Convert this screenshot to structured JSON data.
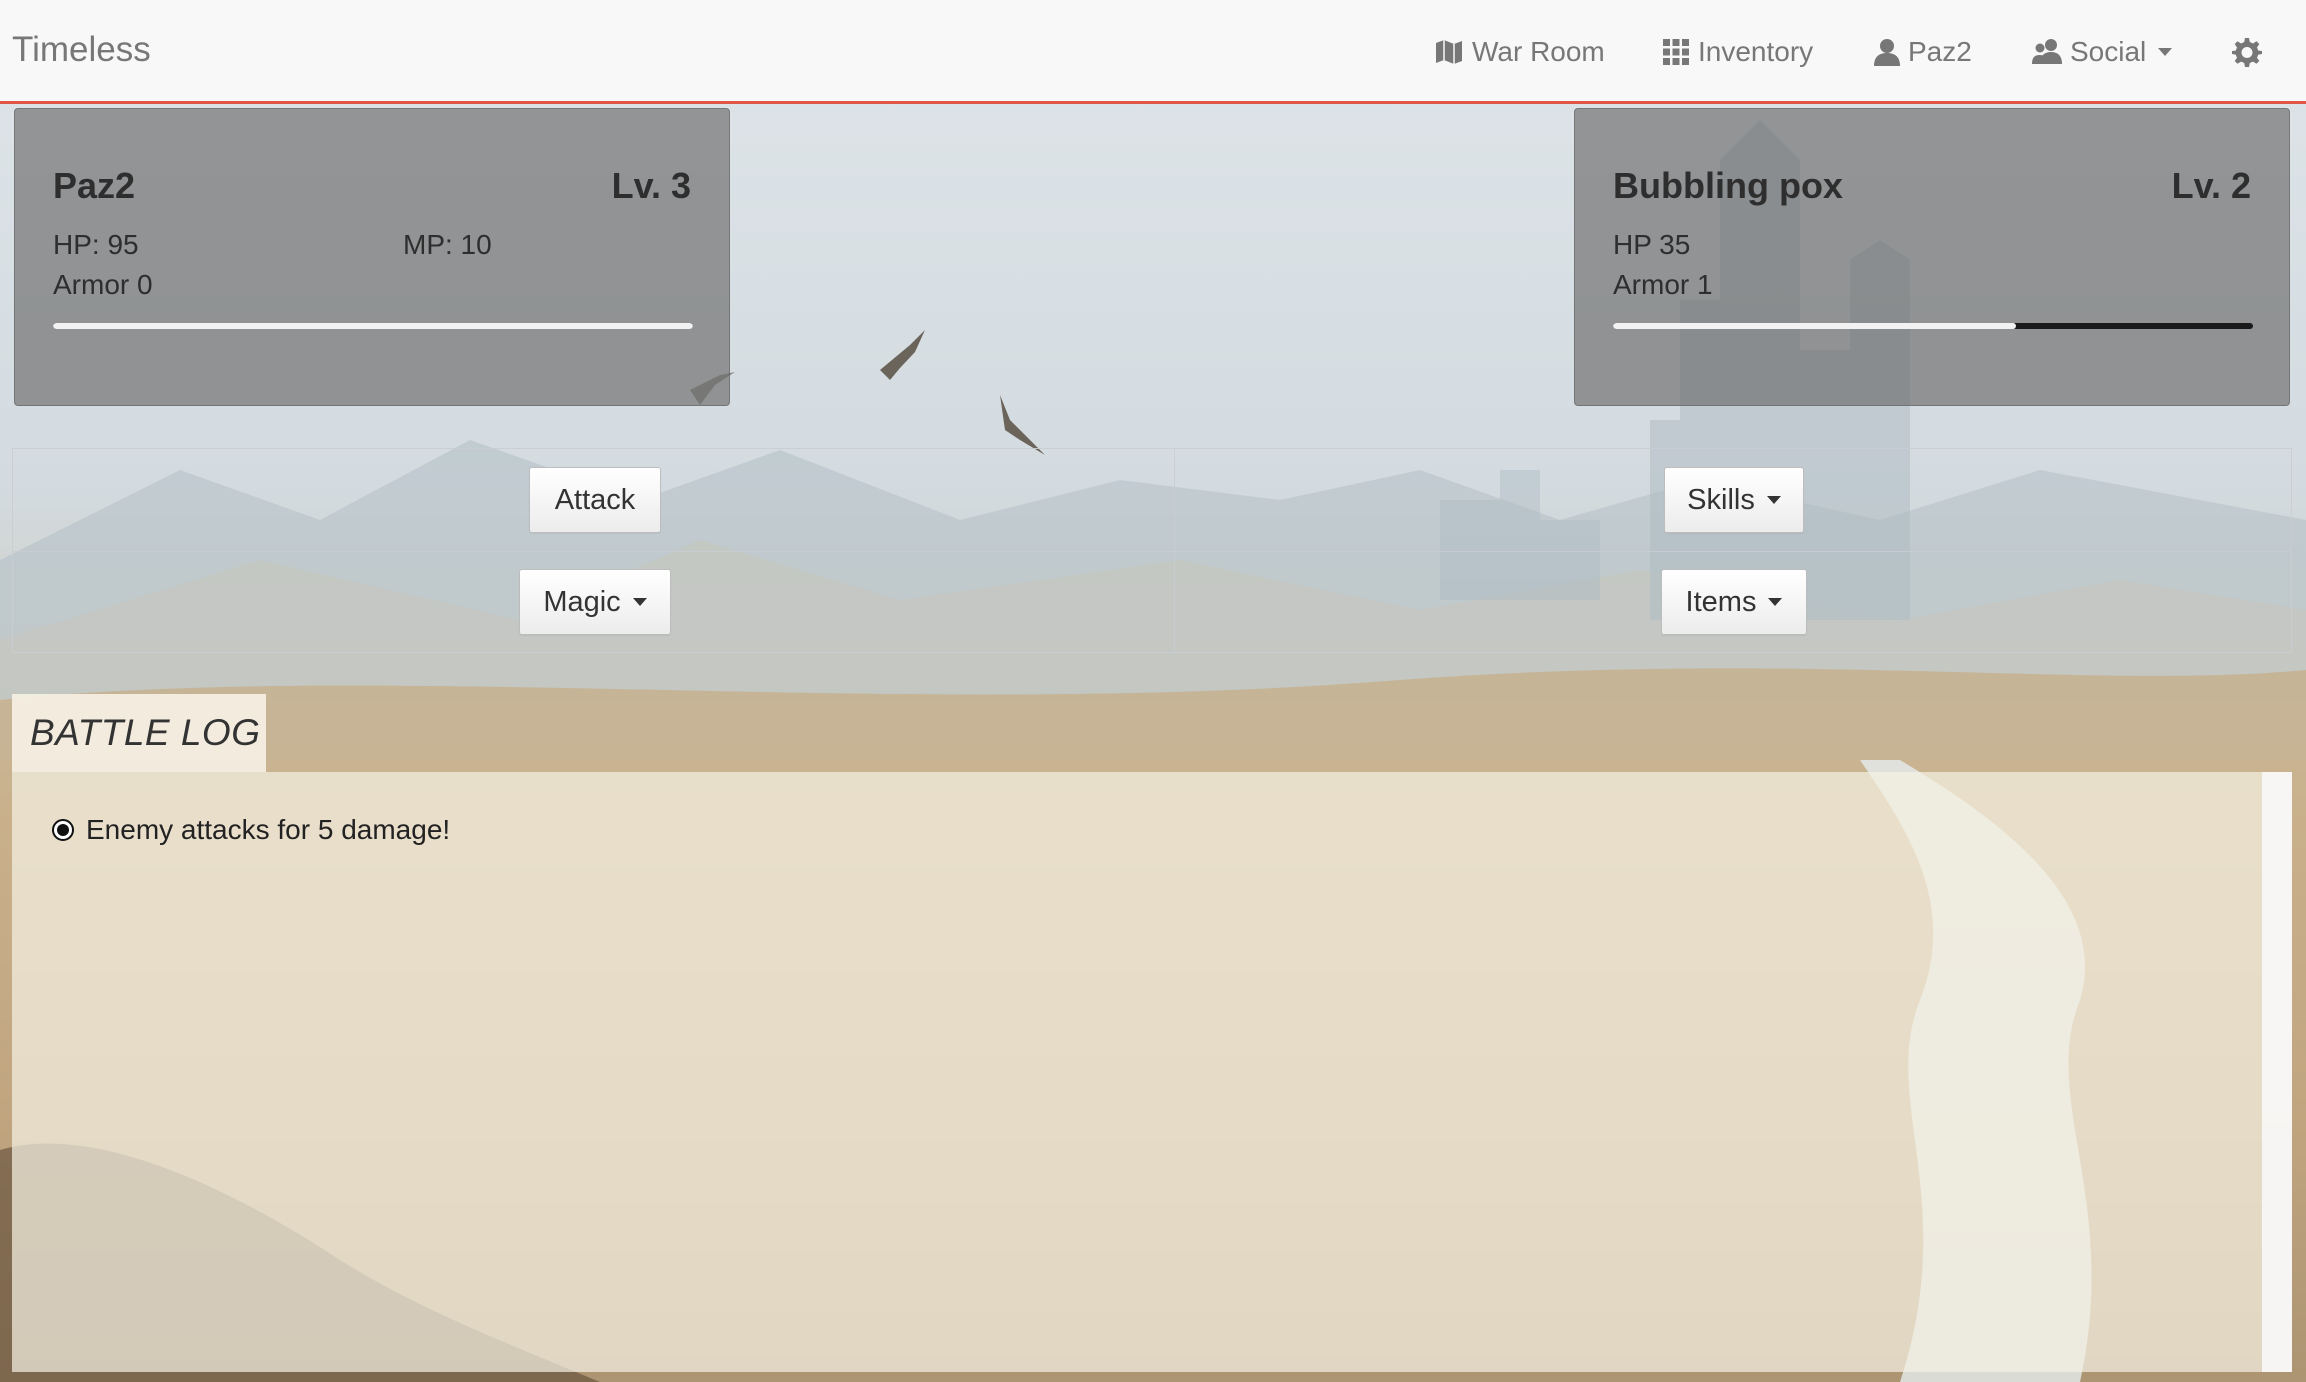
{
  "navbar": {
    "brand": "Timeless",
    "items": [
      {
        "label": "War Room",
        "icon": "map-flag-icon"
      },
      {
        "label": "Inventory",
        "icon": "grid-icon"
      },
      {
        "label": "Paz2",
        "icon": "user-icon"
      },
      {
        "label": "Social",
        "icon": "users-icon",
        "dropdown": true
      }
    ],
    "settings_icon": "gear-icon"
  },
  "player": {
    "name": "Paz2",
    "level": "Lv. 3",
    "hp": "HP: 95",
    "mp": "MP: 10",
    "armor": "Armor 0",
    "hp_fraction": 1.0
  },
  "enemy": {
    "name": "Bubbling pox",
    "level": "Lv. 2",
    "hp": "HP 35",
    "armor": "Armor 1",
    "hp_fraction": 0.63
  },
  "actions": {
    "attack": "Attack",
    "skills": "Skills",
    "magic": "Magic",
    "items": "Items"
  },
  "battle_log": {
    "title": "BATTLE LOG",
    "entries": [
      "Enemy attacks for 5 damage!"
    ]
  },
  "colors": {
    "navbar_border": "#e2564a",
    "panel_bg": "#6e6e6e",
    "hp_fill": "#f2f2f2",
    "hp_track": "#1a1a1a"
  }
}
